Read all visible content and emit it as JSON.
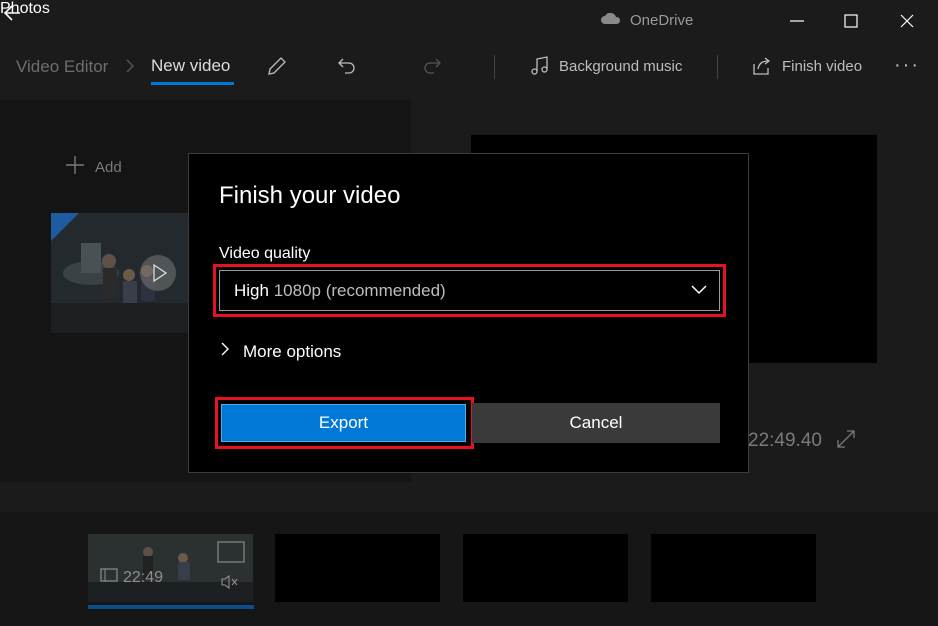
{
  "titlebar": {
    "app_name": "Photos",
    "cloud_label": "OneDrive"
  },
  "toolbar": {
    "breadcrumb_parent": "Video Editor",
    "breadcrumb_current": "New video",
    "background_music_label": "Background music",
    "finish_video_label": "Finish video",
    "more_label": "···"
  },
  "library": {
    "add_label": "Add"
  },
  "preview": {
    "timecode": "22:49.40"
  },
  "storyboard": {
    "clips": [
      {
        "duration": "22:49"
      },
      {
        "duration": ""
      },
      {
        "duration": ""
      },
      {
        "duration": ""
      }
    ]
  },
  "dialog": {
    "title": "Finish your video",
    "quality_label": "Video quality",
    "quality_value_main": "High",
    "quality_value_sub": "1080p (recommended)",
    "more_options_label": "More options",
    "export_label": "Export",
    "cancel_label": "Cancel"
  },
  "colors": {
    "accent": "#0078d7",
    "highlight": "#e81123",
    "background": "#1b1b1b"
  }
}
